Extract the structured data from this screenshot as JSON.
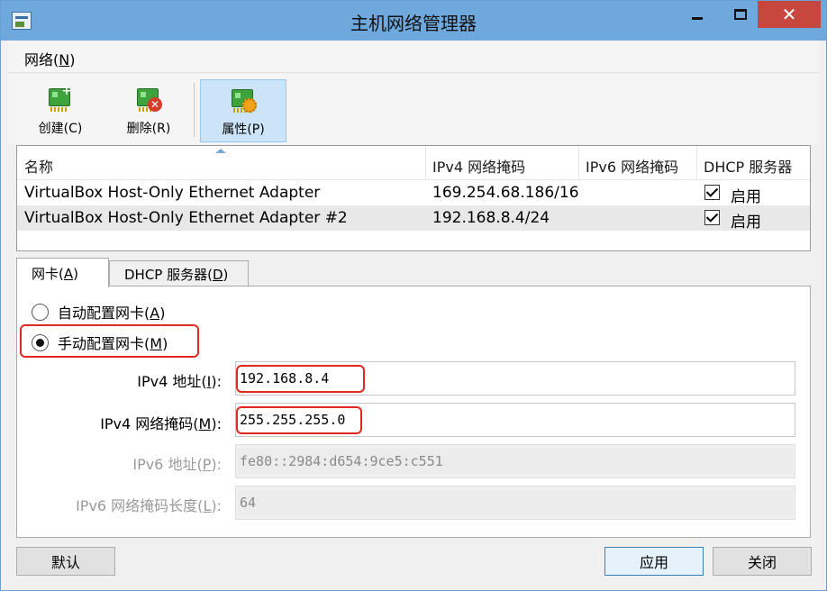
{
  "window": {
    "title": "主机网络管理器"
  },
  "menu": {
    "network_prefix": "网络(",
    "network_key": "N",
    "network_suffix": ")"
  },
  "toolbar": {
    "create": "创建(C)",
    "delete": "删除(R)",
    "properties": "属性(P)"
  },
  "table": {
    "headers": [
      "名称",
      "IPv4 网络掩码",
      "IPv6 网络掩码",
      "DHCP 服务器"
    ],
    "rows": [
      {
        "name": "VirtualBox Host-Only Ethernet Adapter",
        "ipv4": "169.254.68.186/16",
        "ipv6": "",
        "dhcp_checked": true,
        "dhcp_label": "启用"
      },
      {
        "name": "VirtualBox Host-Only Ethernet Adapter #2",
        "ipv4": "192.168.8.4/24",
        "ipv6": "",
        "dhcp_checked": true,
        "dhcp_label": "启用"
      }
    ]
  },
  "tabs": {
    "adapter": {
      "prefix": "网卡(",
      "key": "A",
      "suffix": ")"
    },
    "dhcp": {
      "prefix": "DHCP 服务器(",
      "key": "D",
      "suffix": ")"
    }
  },
  "adapter": {
    "auto": {
      "prefix": "自动配置网卡(",
      "key": "A",
      "suffix": ")",
      "selected": false
    },
    "manual": {
      "prefix": "手动配置网卡(",
      "key": "M",
      "suffix": ")",
      "selected": true
    },
    "ipv4_addr": {
      "prefix": "IPv4 地址(",
      "key": "I",
      "suffix": "):",
      "value": "192.168.8.4"
    },
    "ipv4_mask": {
      "prefix": "IPv4 网络掩码(",
      "key": "M",
      "suffix": "):",
      "value": "255.255.255.0"
    },
    "ipv6_addr": {
      "prefix": "IPv6 地址(",
      "key": "P",
      "suffix": "):",
      "value": "fe80::2984:d654:9ce5:c551"
    },
    "ipv6_len": {
      "prefix": "IPv6 网络掩码长度(",
      "key": "L",
      "suffix": "):",
      "value": "64"
    }
  },
  "buttons": {
    "default": "默认",
    "apply": "应用",
    "close": "关闭"
  },
  "colors": {
    "highlight": "#e0281f",
    "titlebar": "#6fa8dc",
    "close": "#c7463d",
    "active_tool": "#cce4f7"
  }
}
